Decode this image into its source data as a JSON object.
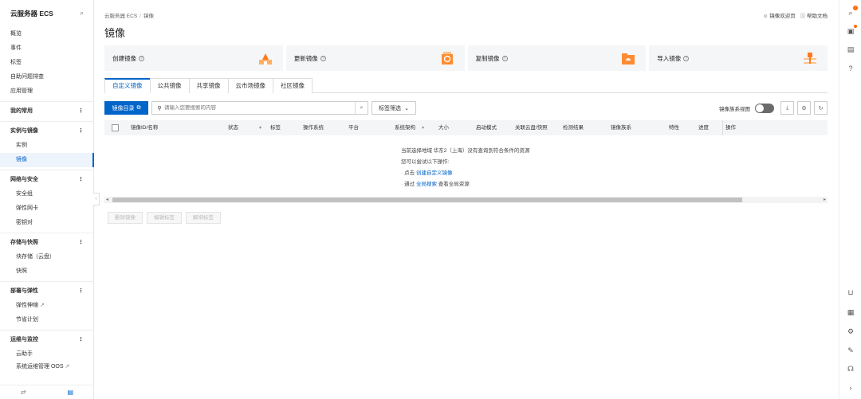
{
  "sidebar": {
    "title": "云服务器 ECS",
    "items": [
      {
        "label": "概览"
      },
      {
        "label": "事件"
      },
      {
        "label": "标签"
      },
      {
        "label": "自助问题排查"
      },
      {
        "label": "应用管理"
      }
    ],
    "favorites": "我的常用",
    "groups": [
      {
        "label": "实例与镜像",
        "children": [
          "实例",
          "镜像"
        ]
      },
      {
        "label": "网络与安全",
        "children": [
          "安全组",
          "弹性网卡",
          "密钥对"
        ]
      },
      {
        "label": "存储与快照",
        "children": [
          "块存储（云盘）",
          "快照"
        ]
      },
      {
        "label": "部署与弹性",
        "children": [
          "弹性伸缩",
          "节省计划"
        ]
      },
      {
        "label": "运维与监控",
        "children": [
          "云助手",
          "系统运维管理 OOS"
        ]
      }
    ]
  },
  "breadcrumb": {
    "root": "云服务器 ECS",
    "sep": "/",
    "current": "镜像"
  },
  "top_links": {
    "welcome": "镜像欢迎页",
    "help": "帮助文档"
  },
  "page_title": "镜像",
  "cards": [
    {
      "label": "创建镜像"
    },
    {
      "label": "更新镜像"
    },
    {
      "label": "复制镜像"
    },
    {
      "label": "导入镜像"
    }
  ],
  "tabs": [
    "自定义镜像",
    "公共镜像",
    "共享镜像",
    "云市场镜像",
    "社区镜像"
  ],
  "toolbar": {
    "catalog_btn": "镜像目录",
    "search_placeholder": "请输入您要搜索的内容",
    "filter_btn": "标签筛选",
    "view_toggle_label": "镜像族系视图"
  },
  "table": {
    "columns": [
      "镜像ID/名称",
      "状态",
      "标签",
      "操作系统",
      "平台",
      "系统架构",
      "大小",
      "启动模式",
      "关联云盘/快照",
      "检测结果",
      "镜像族系",
      "特性",
      "进度",
      "操作"
    ]
  },
  "empty": {
    "line1": "当前选择地域 华东2（上海）没有查询到符合条件的资源",
    "line2": "您可以尝试以下操作:",
    "opt1_prefix": "点击",
    "opt1_link": "创建自定义镜像",
    "opt2_prefix": "通过",
    "opt2_link": "全局搜索",
    "opt2_suffix": "查看全局资源"
  },
  "bottom_actions": [
    "删除镜像",
    "编辑标签",
    "解绑标签"
  ]
}
